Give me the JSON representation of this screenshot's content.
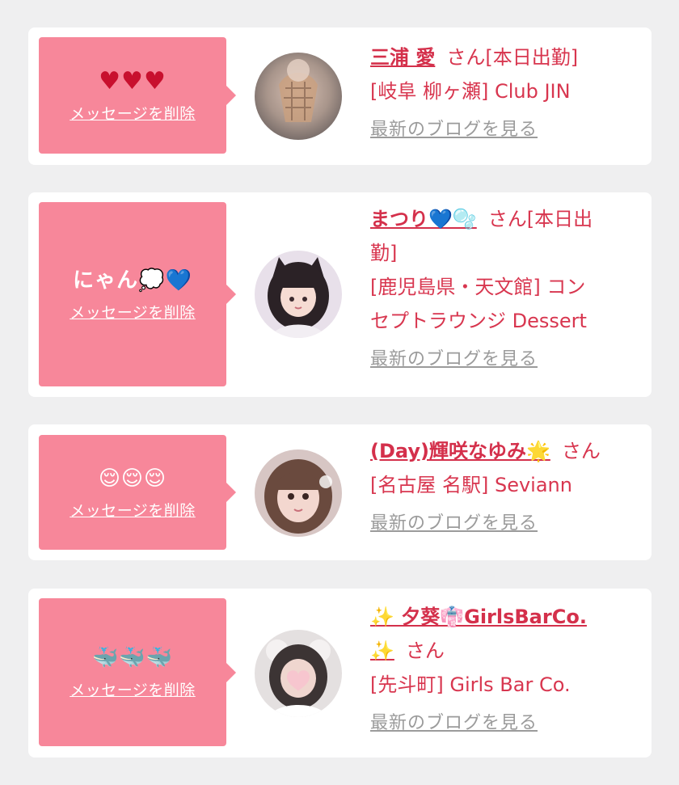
{
  "colors": {
    "background": "#efeff0",
    "card": "#ffffff",
    "bubble": "#f7879a",
    "name_text": "#d4304b",
    "info_text": "#d8364f",
    "blog_link": "#9b9b9b"
  },
  "messages": [
    {
      "stamp": "♥♥♥",
      "delete_label": "メッセージを削除",
      "avatar_icon": "girl-photo-avatar",
      "name": "三浦 愛",
      "suffix": "さん[本日出勤]",
      "shop": "[岐阜 柳ヶ瀬] Club JIN",
      "blog_label": "最新のブログを見る"
    },
    {
      "stamp": "にゃん💭💙",
      "delete_label": "メッセージを削除",
      "avatar_icon": "girl-photo-avatar",
      "name": "まつり💙🫧",
      "suffix": "さん[本日出",
      "suffix2": "勤]",
      "shop": "[鹿児島県・天文館] コン",
      "shop2": "セプトラウンジ Dessert",
      "blog_label": "最新のブログを見る"
    },
    {
      "stamp": "😌😌😌",
      "delete_label": "メッセージを削除",
      "avatar_icon": "girl-photo-avatar",
      "name": "(Day)輝咲なゆみ🌟",
      "suffix": "さん",
      "shop": "[名古屋 名駅] Seviann",
      "blog_label": "最新のブログを見る"
    },
    {
      "stamp": "🐳🐳🐳",
      "delete_label": "メッセージを削除",
      "avatar_icon": "girl-photo-avatar",
      "name": "✨ 夕葵👘GirlsBarCo.",
      "name2": "✨",
      "suffix": "さん",
      "shop": "[先斗町] Girls Bar Co.",
      "blog_label": "最新のブログを見る"
    }
  ]
}
